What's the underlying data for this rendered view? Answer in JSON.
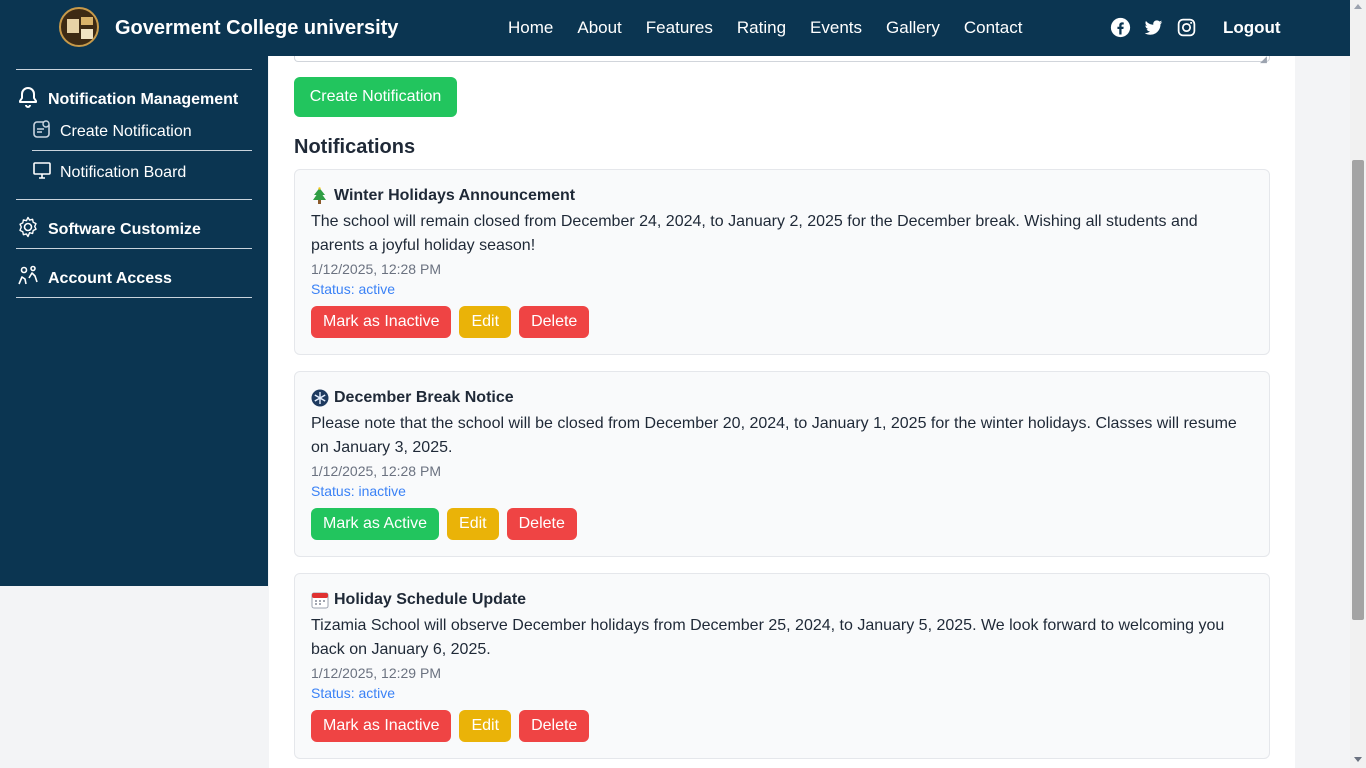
{
  "header": {
    "brand": "Goverment College university",
    "nav": [
      "Home",
      "About",
      "Features",
      "Rating",
      "Events",
      "Gallery",
      "Contact"
    ],
    "social": [
      "facebook-icon",
      "twitter-icon",
      "instagram-icon"
    ],
    "logout": "Logout"
  },
  "sidebar": {
    "notification_management": "Notification Management",
    "create_notification": "Create Notification",
    "notification_board": "Notification Board",
    "software_customize": "Software Customize",
    "account_access": "Account Access"
  },
  "main": {
    "create_button": "Create Notification",
    "section_title": "Notifications",
    "notifications": [
      {
        "icon": "christmas-tree-icon",
        "title": "Winter Holidays Announcement",
        "body": "The school will remain closed from December 24, 2024, to January 2, 2025 for the December break. Wishing all students and parents a joyful holiday season!",
        "date": "1/12/2025, 12:28 PM",
        "status": "Status: active",
        "toggle_label": "Mark as Inactive",
        "edit_label": "Edit",
        "delete_label": "Delete"
      },
      {
        "icon": "snowflake-icon",
        "title": "December Break Notice",
        "body": "Please note that the school will be closed from December 20, 2024, to January 1, 2025 for the winter holidays. Classes will resume on January 3, 2025.",
        "date": "1/12/2025, 12:28 PM",
        "status": "Status: inactive",
        "toggle_label": "Mark as Active",
        "edit_label": "Edit",
        "delete_label": "Delete"
      },
      {
        "icon": "calendar-icon",
        "title": "Holiday Schedule Update",
        "body": "Tizamia School will observe December holidays from December 25, 2024, to January 5, 2025. We look forward to welcoming you back on January 6, 2025.",
        "date": "1/12/2025, 12:29 PM",
        "status": "Status: active",
        "toggle_label": "Mark as Inactive",
        "edit_label": "Edit",
        "delete_label": "Delete"
      }
    ]
  },
  "colors": {
    "navy": "#0b3551",
    "green": "#22c55e",
    "red": "#ef4444",
    "yellow": "#eab308",
    "status_blue": "#3b82f6"
  }
}
